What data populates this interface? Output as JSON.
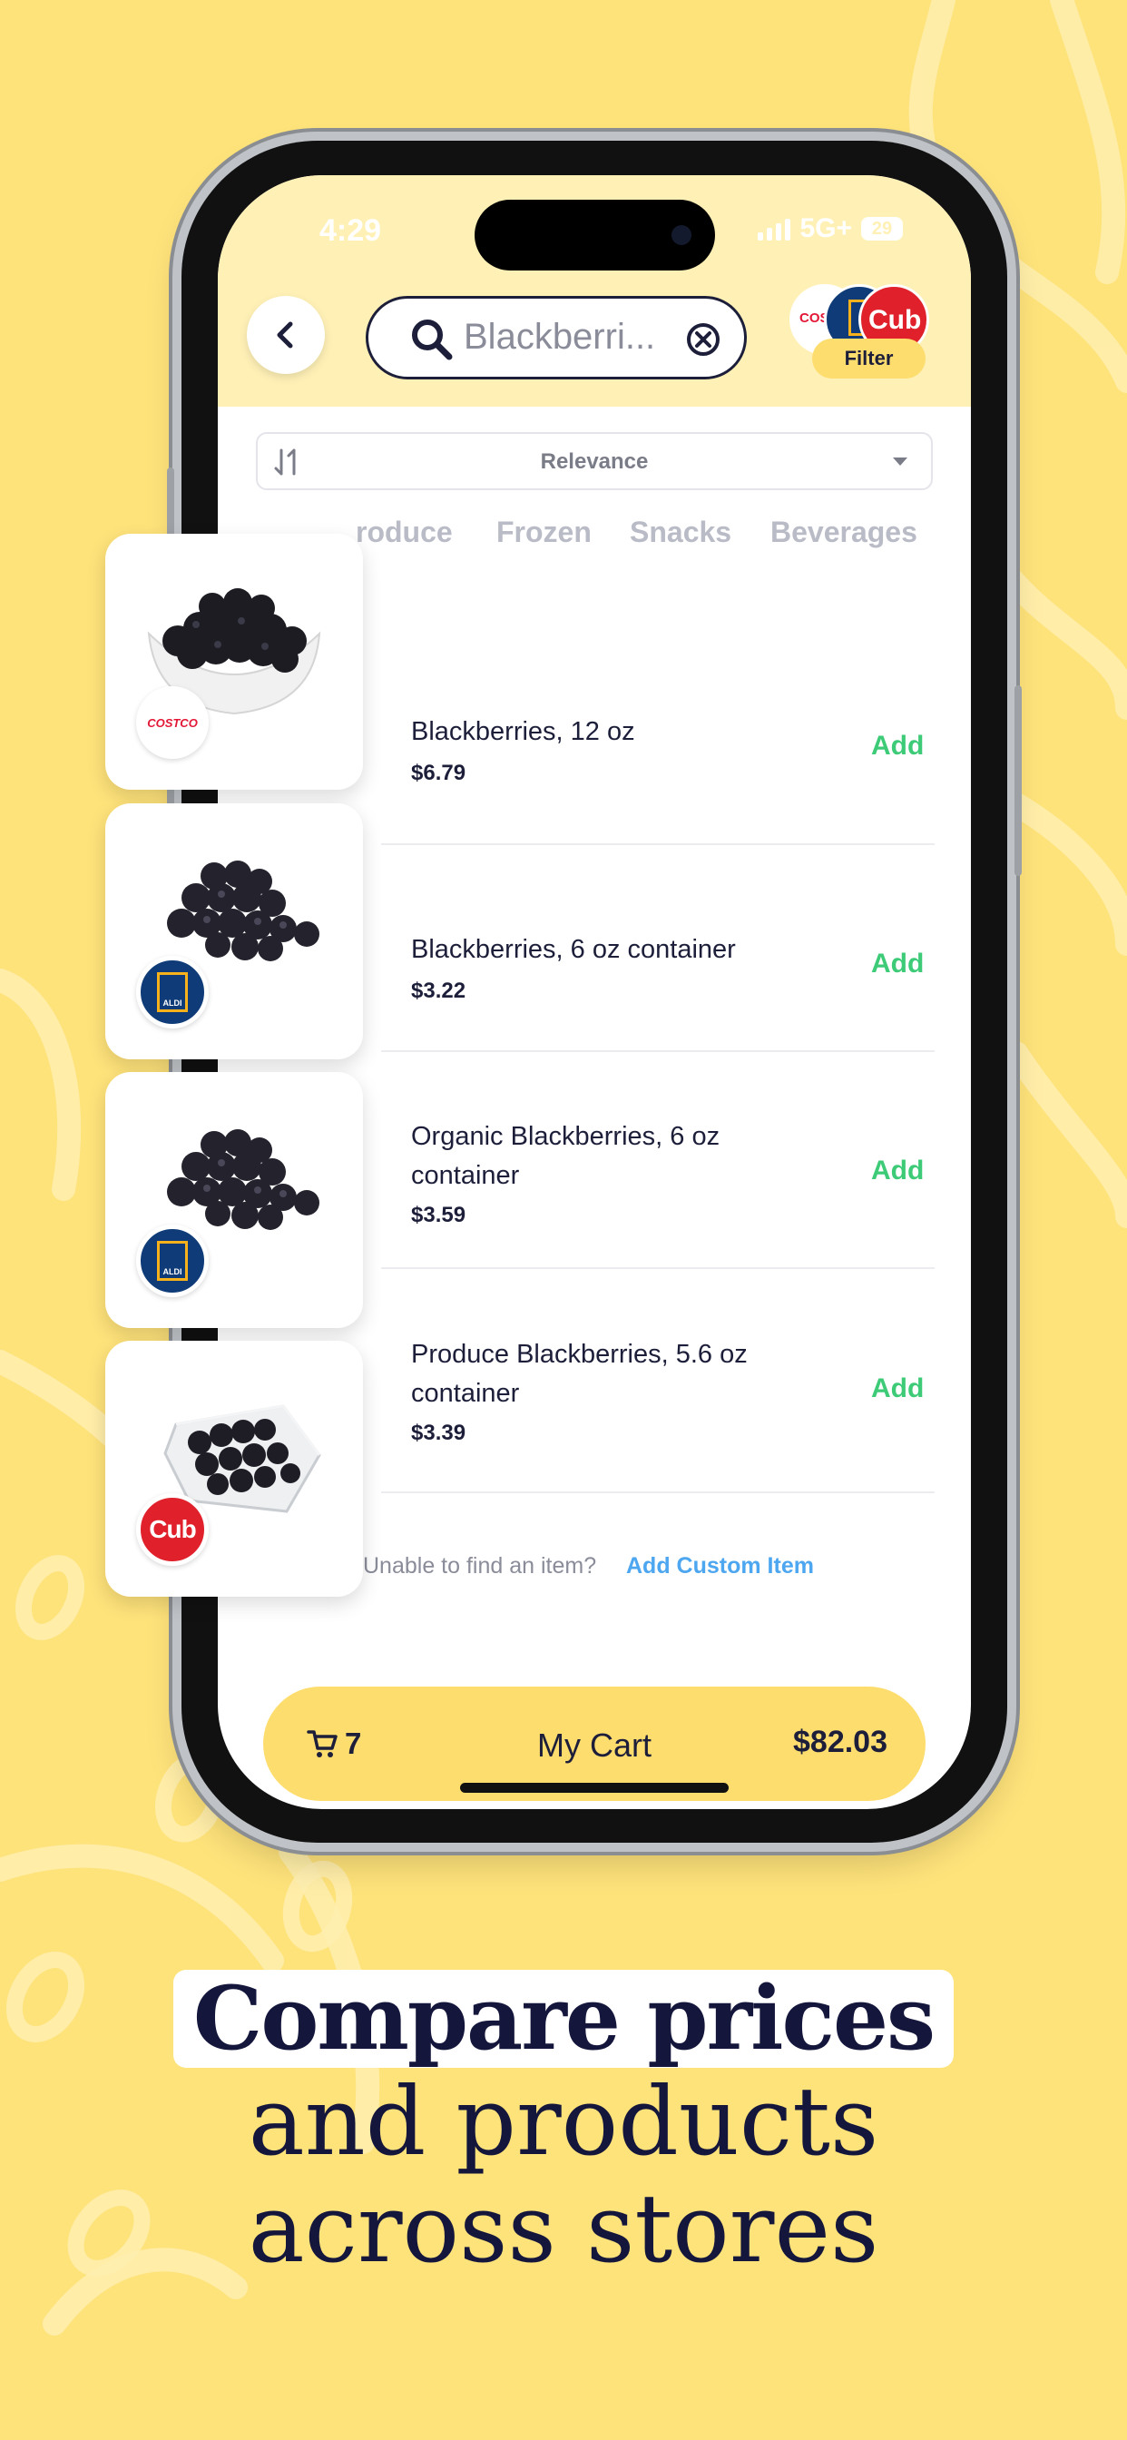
{
  "status_bar": {
    "time": "4:29",
    "network": "5G+",
    "battery": "29"
  },
  "header": {
    "search_value": "Blackberri...",
    "filter_label": "Filter",
    "stores_shown": [
      "Costco",
      "Aldi",
      "Cub"
    ]
  },
  "sort": {
    "label": "Relevance"
  },
  "categories": [
    "roduce",
    "Frozen",
    "Snacks",
    "Beverages"
  ],
  "products": [
    {
      "name": "Blackberries, 12 oz",
      "price": "$6.79",
      "add_label": "Add",
      "store": "Costco"
    },
    {
      "name": "Blackberries, 6 oz container",
      "price": "$3.22",
      "add_label": "Add",
      "store": "Aldi"
    },
    {
      "name": "Organic Blackberries, 6 oz container",
      "price": "$3.59",
      "add_label": "Add",
      "store": "Aldi"
    },
    {
      "name": "Produce Blackberries, 5.6 oz container",
      "price": "$3.39",
      "add_label": "Add",
      "store": "Cub"
    }
  ],
  "store_logos": {
    "costco": "COSTCO",
    "aldi": "ALDI",
    "cub": "Cub"
  },
  "custom_item": {
    "prompt": "Unable to find an item?",
    "link": "Add Custom Item"
  },
  "cart": {
    "count": "7",
    "label": "My Cart",
    "total": "$82.03"
  },
  "headline": {
    "line1": "Compare prices",
    "line2": "and products",
    "line3": "across stores"
  },
  "colors": {
    "background": "#FEE27A",
    "header": "#FFF1B6",
    "accent_yellow": "#FEDD6F",
    "add_green": "#3ECB78",
    "link_blue": "#4DA6F0",
    "navy": "#14163c"
  }
}
